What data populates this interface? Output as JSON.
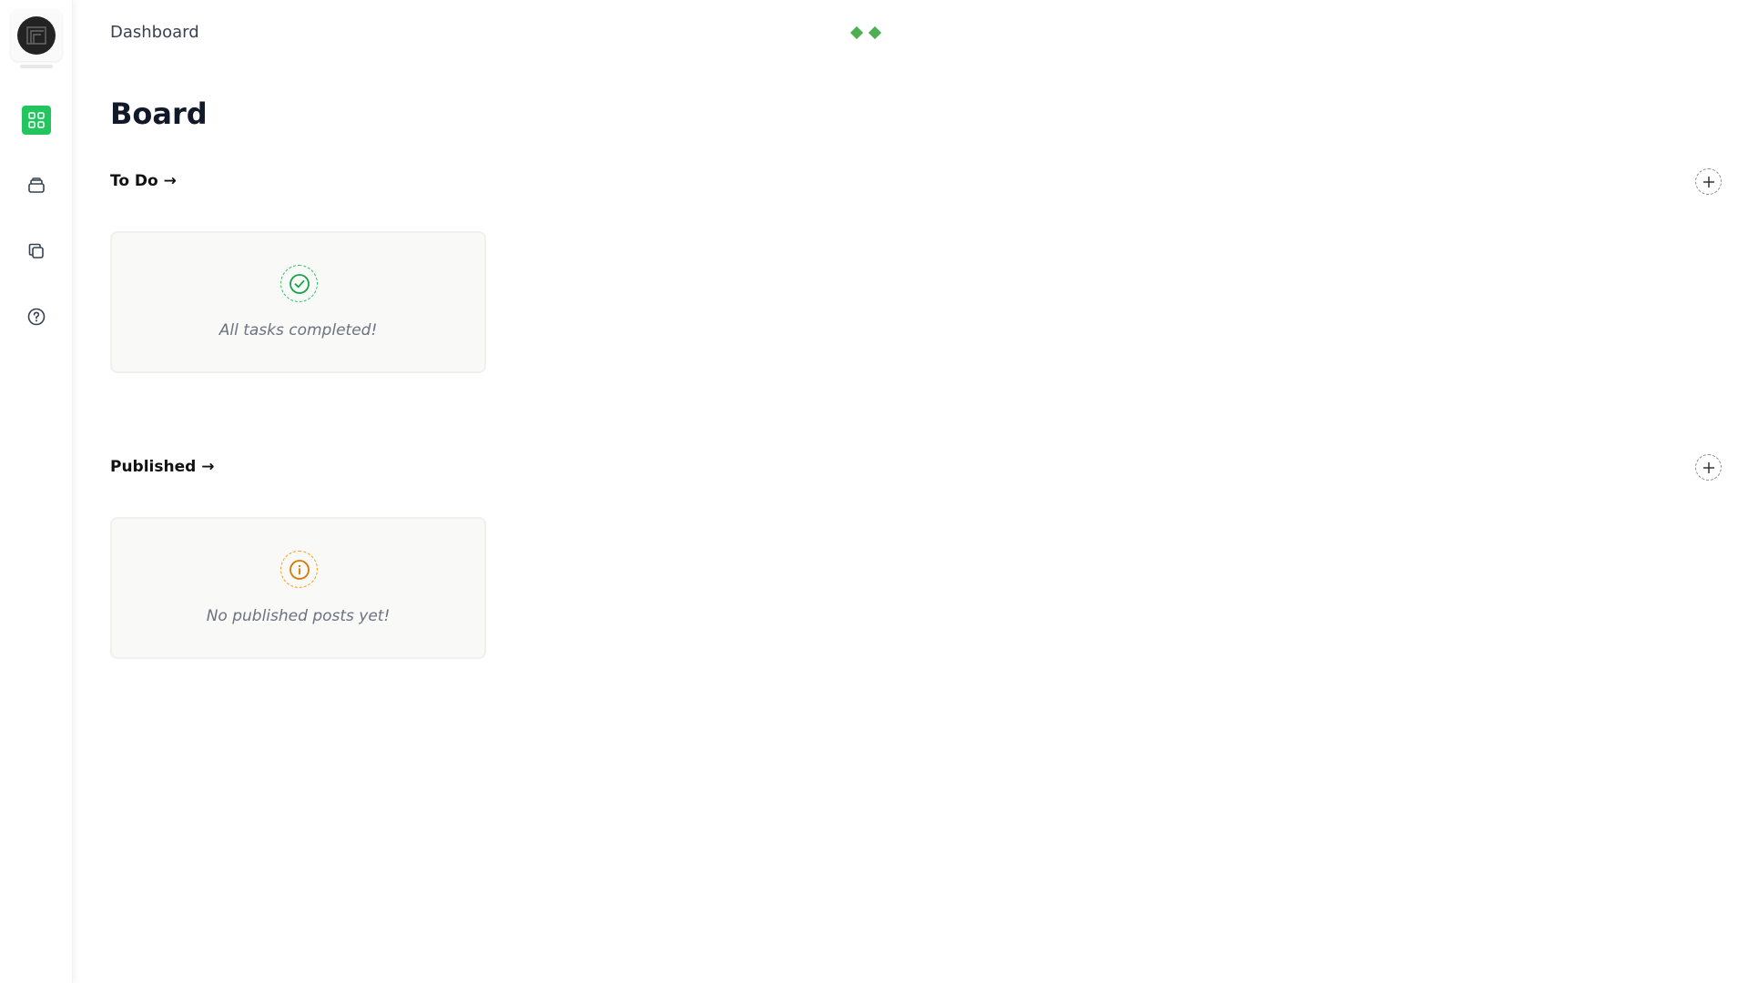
{
  "header": {
    "breadcrumb": "Dashboard"
  },
  "page": {
    "title": "Board"
  },
  "sidebar": {
    "items": [
      {
        "icon": "grid-icon",
        "active": true
      },
      {
        "icon": "inbox-icon",
        "active": false
      },
      {
        "icon": "copy-icon",
        "active": false
      },
      {
        "icon": "help-icon",
        "active": false
      }
    ]
  },
  "sections": {
    "todo": {
      "title": "To Do →",
      "empty_message": "All tasks completed!",
      "empty_icon": "check-circle-icon"
    },
    "published": {
      "title": "Published →",
      "empty_message": "No published posts yet!",
      "empty_icon": "info-icon"
    }
  },
  "colors": {
    "accent": "#22c55e",
    "success": "#22c55e",
    "warning": "#f59e0b",
    "diamond": "#4caf50"
  }
}
